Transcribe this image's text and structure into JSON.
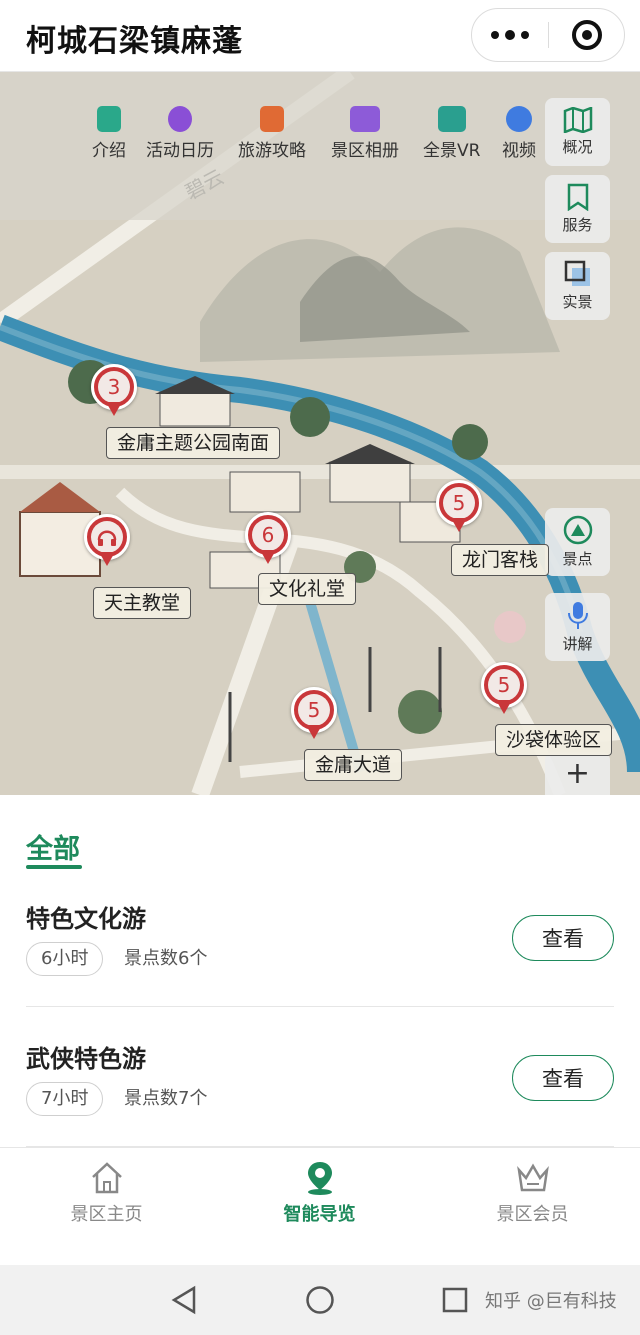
{
  "header": {
    "title": "柯城石梁镇麻蓬",
    "more_icon": "more-dots-icon",
    "close_icon": "target-circle-icon"
  },
  "map": {
    "menu": [
      {
        "label": "介绍",
        "icon": "intro-icon",
        "color": "#2aa88a"
      },
      {
        "label": "活动日历",
        "icon": "calendar-balloon-icon",
        "color": "#8a4fd6"
      },
      {
        "label": "旅游攻略",
        "icon": "guide-book-icon",
        "color": "#e06a34"
      },
      {
        "label": "景区相册",
        "icon": "photo-album-icon",
        "color": "#8d5bd8"
      },
      {
        "label": "全景VR",
        "icon": "panorama-vr-icon",
        "color": "#2a9f8f"
      },
      {
        "label": "视频",
        "icon": "video-play-icon",
        "color": "#3f7be0"
      }
    ],
    "side_buttons": [
      {
        "label": "概况",
        "icon": "map-fold-icon"
      },
      {
        "label": "服务",
        "icon": "bookmark-icon"
      },
      {
        "label": "实景",
        "icon": "layers-icon"
      },
      {
        "label": "景点",
        "icon": "spot-marker-icon"
      },
      {
        "label": "讲解",
        "icon": "microphone-icon"
      }
    ],
    "zoom_in_label": "+",
    "road_label": "碧云",
    "spots": [
      {
        "label": "金庸主题公园南面",
        "count": "3"
      },
      {
        "label": "天主教堂",
        "count": ""
      },
      {
        "label": "文化礼堂",
        "count": "6"
      },
      {
        "label": "龙门客栈",
        "count": "5"
      },
      {
        "label": "金庸大道",
        "count": "5"
      },
      {
        "label": "沙袋体验区",
        "count": "5"
      }
    ]
  },
  "routes": {
    "tab_label": "全部",
    "items": [
      {
        "title": "特色文化游",
        "duration": "6小时",
        "spot_count": "景点数6个",
        "button": "查看"
      },
      {
        "title": "武侠特色游",
        "duration": "7小时",
        "spot_count": "景点数7个",
        "button": "查看"
      }
    ]
  },
  "tabbar": {
    "items": [
      {
        "label": "景区主页",
        "icon": "home-icon",
        "active": false
      },
      {
        "label": "智能导览",
        "icon": "location-pin-icon",
        "active": true
      },
      {
        "label": "景区会员",
        "icon": "crown-member-icon",
        "active": false
      }
    ]
  },
  "system_nav": {
    "watermark": "知乎 @巨有科技"
  },
  "colors": {
    "accent": "#1e8a5c",
    "pin_red": "#c9373a",
    "river_blue": "#3d8fb4"
  }
}
